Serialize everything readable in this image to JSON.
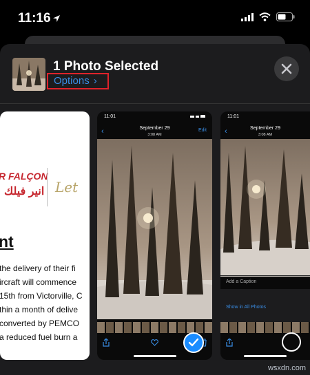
{
  "status_bar": {
    "time": "11:16"
  },
  "sheet": {
    "title": "1 Photo Selected",
    "options_label": "Options",
    "options_chevron": "›",
    "close_icon": "close-icon"
  },
  "document_preview": {
    "brand_latin": "R FALÇON",
    "brand_arabic": "انير فيلك",
    "script_text": "Let",
    "heading": "nt",
    "lines": [
      "the delivery of their fi",
      "ircraft will commence",
      "15th from Victorville, C",
      "thin a month of delive",
      "converted by PEMCO",
      "a reduced fuel burn a"
    ]
  },
  "phone_preview_1": {
    "time": "11:01",
    "date": "September 29",
    "time_sub": "3:08 AM",
    "edit_label": "Edit"
  },
  "phone_preview_2": {
    "time": "11:01",
    "date": "September 29",
    "time_sub": "3:08 AM",
    "caption_placeholder": "Add a Caption",
    "show_all_label": "Show in All Photos"
  },
  "watermark": "wsxdn.com",
  "colors": {
    "accent": "#3a8ee6",
    "highlight_box": "#e0232b",
    "selected": "#1a8cff"
  }
}
